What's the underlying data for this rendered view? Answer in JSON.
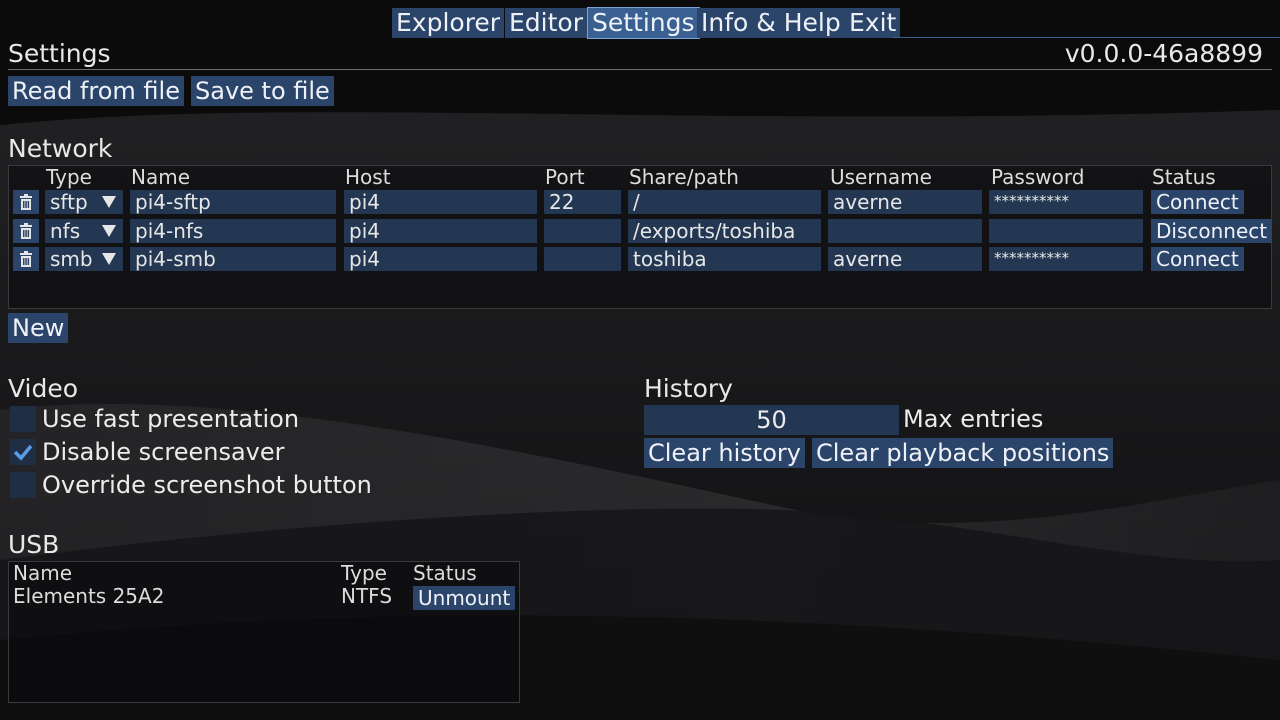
{
  "tabs": [
    {
      "label": "Explorer",
      "active": false
    },
    {
      "label": "Editor",
      "active": false
    },
    {
      "label": "Settings",
      "active": true
    },
    {
      "label": "Info & Help",
      "active": false
    },
    {
      "label": "Exit",
      "active": false
    }
  ],
  "header": {
    "title": "Settings",
    "version": "v0.0.0-46a8899"
  },
  "file_actions": {
    "read_label": "Read from file",
    "save_label": "Save to file"
  },
  "network": {
    "title": "Network",
    "columns": [
      "Type",
      "Name",
      "Host",
      "Port",
      "Share/path",
      "Username",
      "Password",
      "Status"
    ],
    "rows": [
      {
        "type": "sftp",
        "name": "pi4-sftp",
        "host": "pi4",
        "port": "22",
        "path": "/",
        "username": "averne",
        "password": "**********",
        "status": "Connect"
      },
      {
        "type": "nfs",
        "name": "pi4-nfs",
        "host": "pi4",
        "port": "",
        "path": "/exports/toshiba",
        "username": "",
        "password": "",
        "status": "Disconnect"
      },
      {
        "type": "smb",
        "name": "pi4-smb",
        "host": "pi4",
        "port": "",
        "path": "toshiba",
        "username": "averne",
        "password": "**********",
        "status": "Connect"
      }
    ],
    "new_label": "New"
  },
  "video": {
    "title": "Video",
    "options": [
      {
        "label": "Use fast presentation",
        "checked": false
      },
      {
        "label": "Disable screensaver",
        "checked": true
      },
      {
        "label": "Override screenshot button",
        "checked": false
      }
    ]
  },
  "history": {
    "title": "History",
    "max_entries_value": "50",
    "max_entries_label": "Max entries",
    "clear_history_label": "Clear history",
    "clear_positions_label": "Clear playback positions"
  },
  "usb": {
    "title": "USB",
    "columns": [
      "Name",
      "Type",
      "Status"
    ],
    "rows": [
      {
        "name": "Elements 25A2",
        "type": "NTFS",
        "status": "Unmount"
      }
    ]
  },
  "icons": {
    "delete": "trash-icon",
    "dropdown": "triangle-down-icon",
    "check": "checkmark-icon"
  },
  "colors": {
    "button": "#2b4469",
    "button_active": "#3a5f91",
    "field": "#233752",
    "background": "#0b0b0c"
  }
}
